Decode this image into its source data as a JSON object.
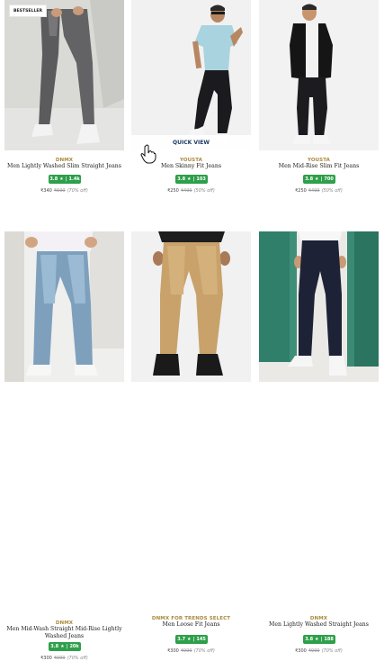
{
  "badges": {
    "bestseller": "BESTSELLER"
  },
  "overlay": {
    "quick_view": "QUICK VIEW"
  },
  "products": [
    {
      "brand": "DNMX",
      "name": "Men Lightly Washed Slim Straight Jeans",
      "rating": "3.8",
      "rating_star": "★",
      "rating_count": "1.4k",
      "price": "₹340",
      "mrp": "₹699",
      "discount": "(70% off)"
    },
    {
      "brand": "YOUSTA",
      "name": "Men Skinny Fit Jeans",
      "rating": "3.8",
      "rating_star": "★",
      "rating_count": "103",
      "price": "₹250",
      "mrp": "₹499",
      "discount": "(50% off)"
    },
    {
      "brand": "YOUSTA",
      "name": "Men Mid-Rise Slim Fit Jeans",
      "rating": "3.8",
      "rating_star": "★",
      "rating_count": "700",
      "price": "₹250",
      "mrp": "₹499",
      "discount": "(50% off)"
    },
    {
      "brand": "DNMX",
      "name": "Men Mid-Wash Straight Mid-Rise Lightly Washed Jeans",
      "rating": "3.8",
      "rating_star": "★",
      "rating_count": "20k",
      "price": "₹300",
      "mrp": "₹999",
      "discount": "(70% off)"
    },
    {
      "brand": "DNMX FOR TRENDS SELECT",
      "name": "Men Loose Fit Jeans",
      "rating": "3.7",
      "rating_star": "★",
      "rating_count": "145",
      "price": "₹300",
      "mrp": "₹999",
      "discount": "(70% off)"
    },
    {
      "brand": "DNMX",
      "name": "Men Lightly Washed Straight Jeans",
      "rating": "3.8",
      "rating_star": "★",
      "rating_count": "188",
      "price": "₹300",
      "mrp": "₹999",
      "discount": "(70% off)"
    }
  ],
  "icons": {
    "cursor": "hand-pointer-icon"
  }
}
